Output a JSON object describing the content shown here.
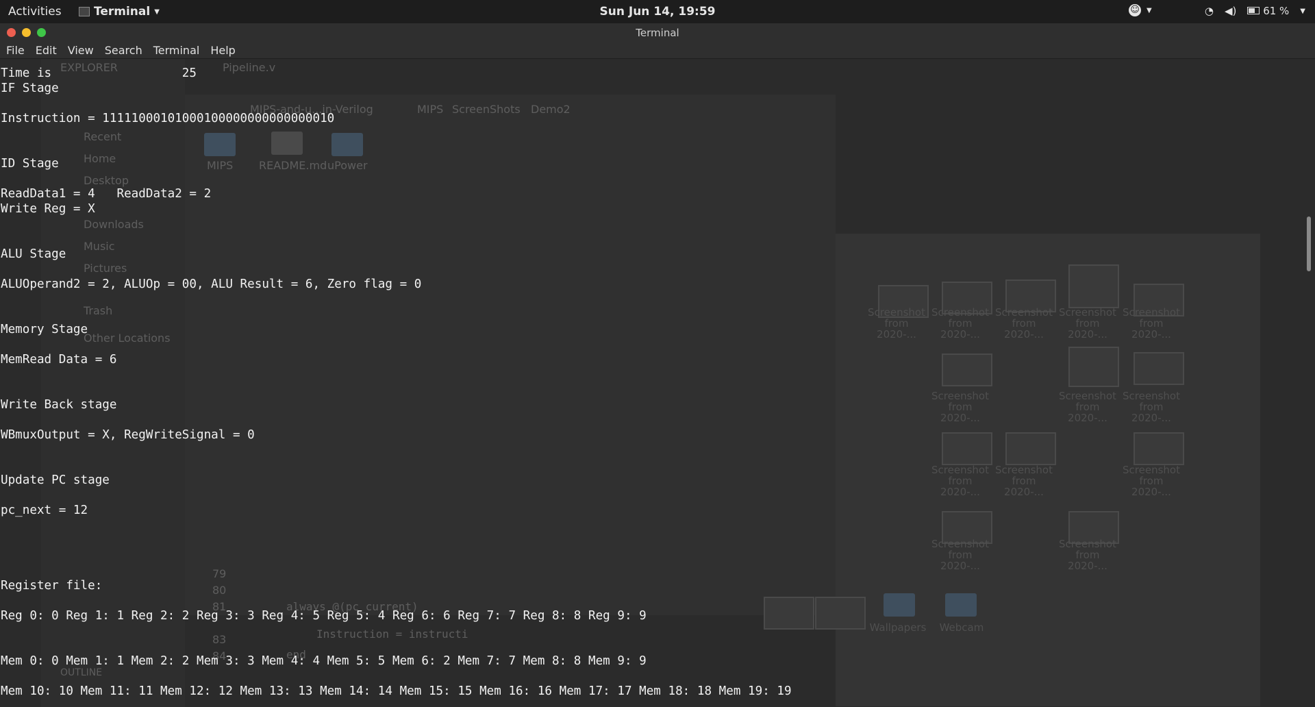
{
  "topbar": {
    "activities": "Activities",
    "app_name": "Terminal",
    "clock": "Sun Jun 14, 19:59",
    "battery": "61 %"
  },
  "window": {
    "title": "Terminal",
    "close_color": "#ed5f50",
    "minimize_color": "#f6be2d",
    "maximize_color": "#3fc648"
  },
  "menu": [
    "File",
    "Edit",
    "View",
    "Search",
    "Terminal",
    "Help"
  ],
  "terminal_lines": [
    "Time is                  25",
    "IF Stage",
    "",
    "Instruction = 11111000101000100000000000000010",
    "",
    "",
    "ID Stage",
    "",
    "ReadData1 = 4   ReadData2 = 2",
    "Write Reg = X",
    "",
    "",
    "ALU Stage",
    "",
    "ALUOperand2 = 2, ALUOp = 00, ALU Result = 6, Zero flag = 0",
    "",
    "",
    "Memory Stage",
    "",
    "MemRead Data = 6",
    "",
    "",
    "Write Back stage",
    "",
    "WBmuxOutput = X, RegWriteSignal = 0",
    "",
    "",
    "Update PC stage",
    "",
    "pc_next = 12",
    "",
    "",
    "",
    "",
    "Register file:",
    "",
    "Reg 0: 0 Reg 1: 1 Reg 2: 2 Reg 3: 3 Reg 4: 5 Reg 5: 4 Reg 6: 6 Reg 7: 7 Reg 8: 8 Reg 9: 9",
    "",
    "",
    "Mem 0: 0 Mem 1: 1 Mem 2: 2 Mem 3: 3 Mem 4: 4 Mem 5: 5 Mem 6: 2 Mem 7: 7 Mem 8: 8 Mem 9: 9",
    "",
    "Mem 10: 10 Mem 11: 11 Mem 12: 12 Mem 13: 13 Mem 14: 14 Mem 15: 15 Mem 16: 16 Mem 17: 17 Mem 18: 18 Mem 19: 19"
  ],
  "ghost": {
    "editor_tab": "Pipeline.v",
    "explorer": "EXPLORER",
    "path_tabs": [
      "MIPS-and-u...in-Verilog",
      "MIPS",
      "ScreenShots",
      "Demo2"
    ],
    "sidebar": [
      "Recent",
      "Home",
      "Desktop",
      "Downloads",
      "Music",
      "Pictures",
      "Trash",
      "Other Locations"
    ],
    "folders": [
      "MIPS",
      "README.md",
      "uPower"
    ],
    "code": [
      "always @(pc_current)",
      "Instruction = instructi",
      "end"
    ],
    "line_numbers": [
      "79",
      "80",
      "81",
      "83",
      "84"
    ],
    "outline": "OUTLINE",
    "thumb_label": "Screenshot from 2020-...",
    "wallpapers": "Wallpapers",
    "webcam": "Webcam"
  }
}
